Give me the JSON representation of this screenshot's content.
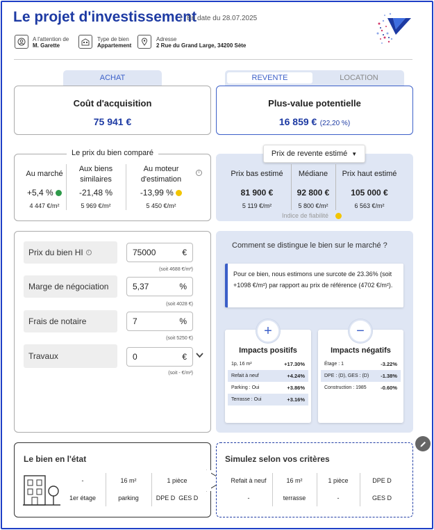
{
  "header": {
    "title": "Le projet d'investissement",
    "date": "En date du 28.07.2025",
    "attention_label": "A l'attention de",
    "attention_value": "M. Garette",
    "type_label": "Type de bien",
    "type_value": "Appartement",
    "address_label": "Adresse",
    "address_value": "2 Rue du Grand Large, 34200 Sète"
  },
  "tabs": {
    "achat": "ACHAT",
    "revente": "REVENTE",
    "location": "LOCATION"
  },
  "acquisition": {
    "title": "Coût d'acquisition",
    "value": "75 941 €"
  },
  "plusvalue": {
    "title": "Plus-value potentielle",
    "value": "16 859 €",
    "pct": "(22,20 %)"
  },
  "compare": {
    "title": "Le prix du bien comparé",
    "cols": [
      {
        "label": "Au marché",
        "pct": "+5,4 %",
        "sqm": "4 447 €/m²",
        "dot": "#2e9a4a"
      },
      {
        "label": "Aux biens similaires",
        "pct": "-21,48 %",
        "sqm": "5 969 €/m²"
      },
      {
        "label": "Au moteur d'estimation",
        "pct": "-13,99 %",
        "sqm": "5 450 €/m²",
        "dot": "#f2c500"
      }
    ]
  },
  "revente": {
    "dropdown": "Prix de revente estimé",
    "cols": [
      {
        "label": "Prix bas estimé",
        "value": "81 900 €",
        "sqm": "5 119 €/m²"
      },
      {
        "label": "Médiane",
        "value": "92 800 €",
        "sqm": "5 800 €/m²"
      },
      {
        "label": "Prix haut estimé",
        "value": "105 000 €",
        "sqm": "6 563 €/m²"
      }
    ],
    "fiability": "Indice de fiabilité",
    "fiability_color": "#f2c500"
  },
  "form": {
    "rows": [
      {
        "label": "Prix du bien HI",
        "value": "75000",
        "unit": "€",
        "note": "(soit 4688 €/m²)"
      },
      {
        "label": "Marge de négociation",
        "value": "5,37",
        "unit": "%",
        "note": "(soit 4028 €)"
      },
      {
        "label": "Frais de notaire",
        "value": "7",
        "unit": "%",
        "note": "(soit 5250 €)"
      },
      {
        "label": "Travaux",
        "value": "0",
        "unit": "€",
        "note": "(soit - €/m²)"
      }
    ]
  },
  "distinct": {
    "title": "Comment se distingue le bien sur le marché ?",
    "text": "Pour ce bien, nous estimons une surcote de 23.36% (soit +1098 €/m²) par rapport au prix de référence (4702 €/m²).",
    "positive": {
      "title": "Impacts positifs",
      "rows": [
        {
          "label": "1p, 16 m²",
          "value": "+17.30%"
        },
        {
          "label": "Refait à neuf",
          "value": "+4.24%"
        },
        {
          "label": "Parking : Oui",
          "value": "+3.86%"
        },
        {
          "label": "Terrasse : Oui",
          "value": "+3.16%"
        }
      ]
    },
    "negative": {
      "title": "Impacts négatifs",
      "rows": [
        {
          "label": "Étage : 1",
          "value": "-3.22%"
        },
        {
          "label": "DPE : (D), GES : (D)",
          "value": "-1.38%"
        },
        {
          "label": "Construction : 1985",
          "value": "-0.60%"
        }
      ]
    }
  },
  "etat": {
    "title": "Le bien en l'état",
    "cells": [
      [
        "-",
        "1er étage"
      ],
      [
        "16 m²",
        "parking"
      ],
      [
        "1 pièce",
        "DPE D  GES D"
      ]
    ]
  },
  "simulez": {
    "title": "Simulez selon vos critères",
    "cells": [
      [
        "Refait à neuf",
        "-"
      ],
      [
        "16 m²",
        "terrasse"
      ],
      [
        "1 pièce",
        "-"
      ],
      [
        "DPE D",
        "GES D"
      ]
    ]
  },
  "colors": {
    "primary": "#1d3aa3",
    "accent_bar": "#3b5fc8"
  }
}
